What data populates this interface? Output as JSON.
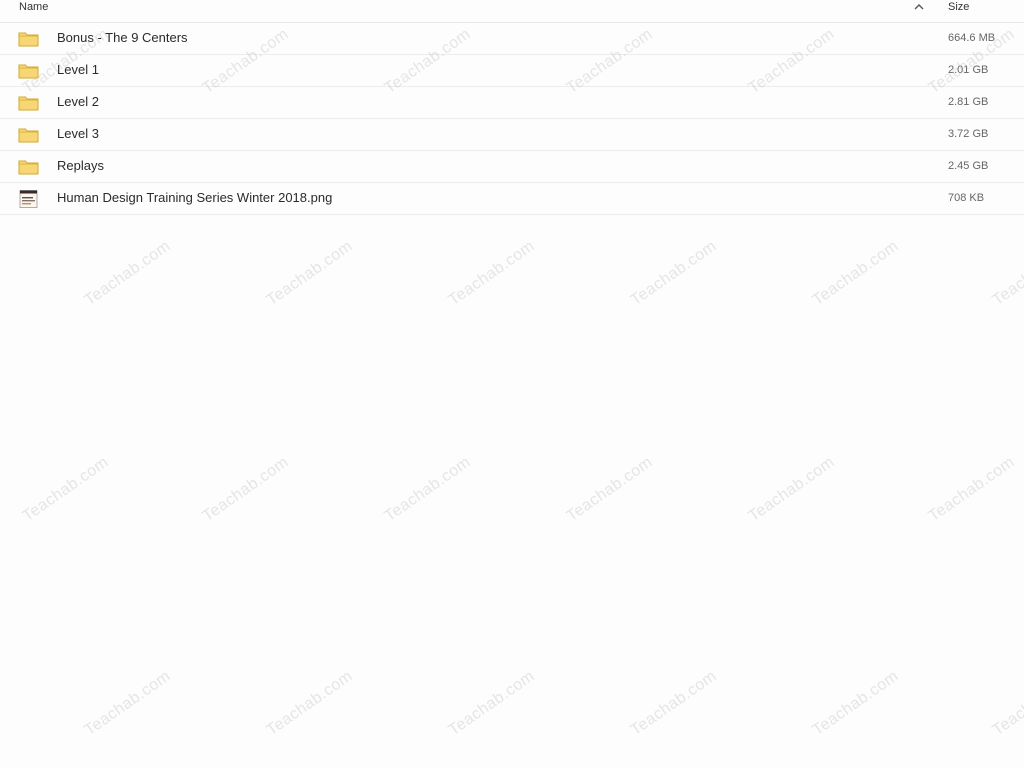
{
  "header": {
    "name_label": "Name",
    "size_label": "Size",
    "sort_icon": "chevron-up-icon"
  },
  "files": [
    {
      "name": "Bonus - The 9 Centers",
      "size": "664.6 MB",
      "type": "folder",
      "icon": "folder-icon"
    },
    {
      "name": "Level 1",
      "size": "2.01 GB",
      "type": "folder",
      "icon": "folder-icon"
    },
    {
      "name": "Level 2",
      "size": "2.81 GB",
      "type": "folder",
      "icon": "folder-icon"
    },
    {
      "name": "Level 3",
      "size": "3.72 GB",
      "type": "folder",
      "icon": "folder-icon"
    },
    {
      "name": "Replays",
      "size": "2.45 GB",
      "type": "folder",
      "icon": "folder-icon"
    },
    {
      "name": "Human Design Training Series Winter 2018.png",
      "size": "708 KB",
      "type": "image",
      "icon": "image-file-icon"
    }
  ],
  "watermark": {
    "text": "Teachab.com"
  },
  "colors": {
    "folder_fill": "#f7d774",
    "folder_stroke": "#d4a832",
    "background": "#fdfdfd"
  }
}
